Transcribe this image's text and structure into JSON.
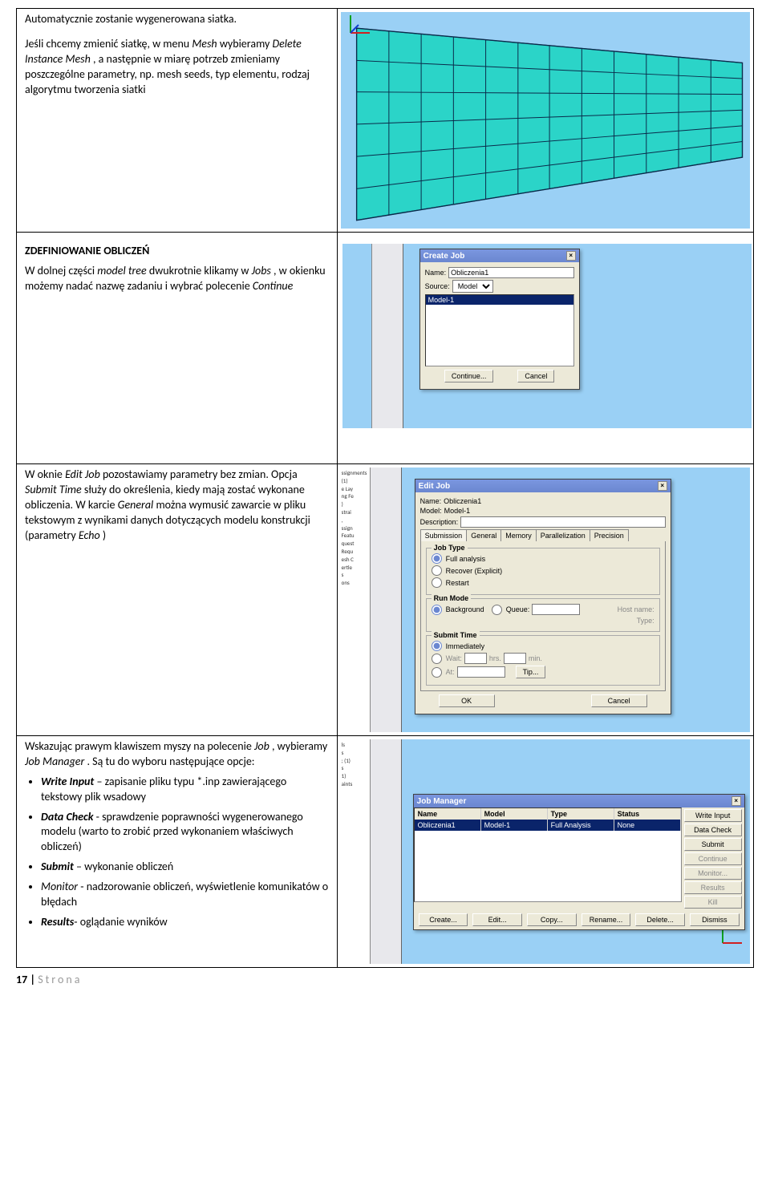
{
  "row1": {
    "p1_a": "Automatycznie zostanie wygenerowana siatka.",
    "p2_a": "Jeśli chcemy zmienić siatkę, w menu ",
    "p2_i1": "Mesh",
    "p2_b": " wybieramy ",
    "p2_i2": "Delete Instance Mesh",
    "p2_c": ", a następnie w miarę potrzeb zmieniamy poszczególne parametry, np. mesh seeds, typ elementu, rodzaj algorytmu tworzenia siatki"
  },
  "row2": {
    "heading": "ZDEFINIOWANIE OBLICZEŃ",
    "p1_a": "W dolnej części ",
    "p1_i1": "model tree",
    "p1_b": " dwukrotnie klikamy w ",
    "p1_i2": "Jobs",
    "p1_c": ", w okienku możemy nadać nazwę zadaniu i wybrać polecenie ",
    "p1_i3": "Continue",
    "dlg": {
      "title": "Create Job",
      "name_label": "Name:",
      "name_value": "Obliczenia1",
      "source_label": "Source:",
      "source_value": "Model",
      "list_item": "Model-1",
      "continue": "Continue...",
      "cancel": "Cancel"
    }
  },
  "row3": {
    "p1_a": "W oknie ",
    "p1_i1": "Edit Job",
    "p1_b": " pozostawiamy parametry bez zmian. Opcja ",
    "p1_i2": "Submit Time",
    "p1_c": " służy do określenia, kiedy mają zostać wykonane obliczenia. W karcie ",
    "p1_i3": "General",
    "p1_d": " można wymusić zawarcie w pliku tekstowym z wynikami danych dotyczących modelu konstrukcji (parametry ",
    "p1_i4": "Echo",
    "p1_e": ")",
    "tree": [
      "ssignments (1)",
      "e Lay",
      "ng Fe",
      "",
      ")",
      "strai",
      ",",
      "ssign",
      "Featu",
      "",
      "quest",
      "Requ",
      "",
      "esh C",
      "",
      "ertie",
      "s",
      "",
      "ons"
    ],
    "dlg": {
      "title": "Edit Job",
      "name_label": "Name:",
      "name_value": "Obliczenia1",
      "model_label": "Model:",
      "model_value": "Model-1",
      "desc_label": "Description:",
      "tabs": [
        "Submission",
        "General",
        "Memory",
        "Parallelization",
        "Precision"
      ],
      "group_jobtype": "Job Type",
      "jt1": "Full analysis",
      "jt2": "Recover (Explicit)",
      "jt3": "Restart",
      "group_runmode": "Run Mode",
      "rm1": "Background",
      "rm2": "Queue:",
      "host_label": "Host name:",
      "type_label": "Type:",
      "group_submittime": "Submit Time",
      "st1": "Immediately",
      "st2": "Wait:",
      "hrs": "hrs.",
      "min": "min.",
      "st3": "At:",
      "tip": "Tip...",
      "ok": "OK",
      "cancel": "Cancel"
    }
  },
  "row4": {
    "p1_a": "Wskazując prawym klawiszem myszy na polecenie ",
    "p1_i1": "Job",
    "p1_b": ", wybieramy ",
    "p1_i2": "Job Manager",
    "p1_c": ". Są tu do wyboru następujące opcje:",
    "li1_b": "Write Input",
    "li1_t": " – zapisanie pliku typu *.inp zawierającego tekstowy plik wsadowy",
    "li2_b": "Data Check",
    "li2_t": " - sprawdzenie poprawności wygenerowanego modelu (warto to zrobić przed wykonaniem właściwych obliczeń)",
    "li3_b": "Submit",
    "li3_t": " – wykonanie obliczeń",
    "li4_i": "Monitor",
    "li4_t": " - nadzorowanie obliczeń, wyświetlenie komunikatów o błędach",
    "li5_b": "Results",
    "li5_t": "- oglądanie wyników",
    "tree": [
      "ls",
      "s",
      "",
      "",
      "; (1)",
      "",
      "s",
      "",
      "",
      "",
      "",
      "",
      "",
      "1)",
      "",
      "aints"
    ],
    "dlg": {
      "title": "Job Manager",
      "h_name": "Name",
      "h_model": "Model",
      "h_type": "Type",
      "h_status": "Status",
      "r_name": "Obliczenia1",
      "r_model": "Model-1",
      "r_type": "Full Analysis",
      "r_status": "None",
      "side": [
        "Write Input",
        "Data Check",
        "Submit",
        "Continue",
        "Monitor...",
        "Results",
        "Kill"
      ],
      "bottom": [
        "Create...",
        "Edit...",
        "Copy...",
        "Rename...",
        "Delete...",
        "Dismiss"
      ]
    }
  },
  "footer": {
    "page": "17 | ",
    "label": "Strona"
  }
}
